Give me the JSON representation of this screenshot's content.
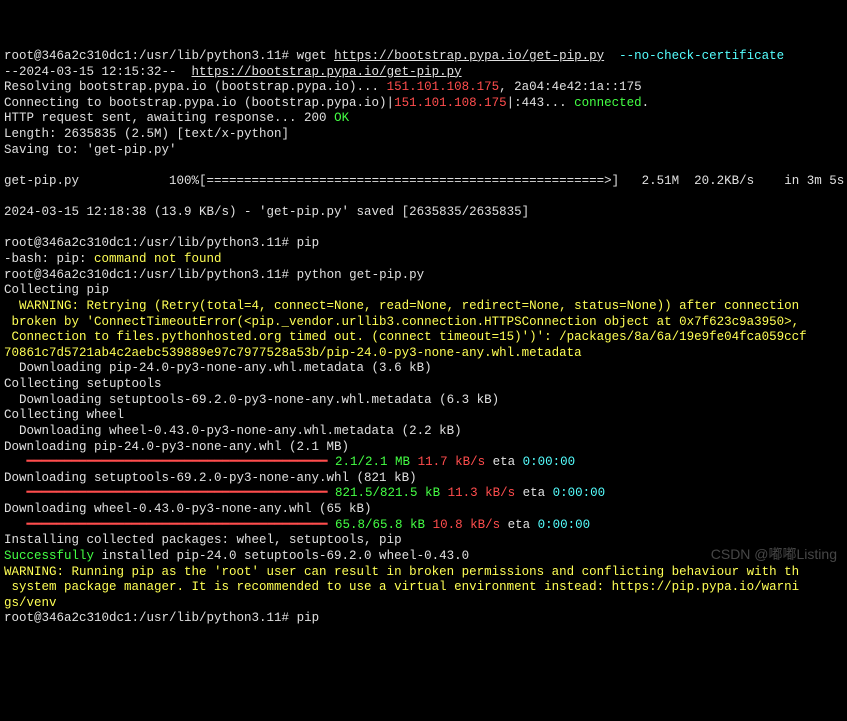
{
  "prompt": "root@346a2c310dc1:/usr/lib/python3.11#",
  "cmd": {
    "wget": "wget",
    "url": "https://bootstrap.pypa.io/get-pip.py",
    "flag": "--no-check-certificate",
    "pip": "pip",
    "python": "python get-pip.py"
  },
  "ts_start": "--2024-03-15 12:15:32--  ",
  "url2": "https://bootstrap.pypa.io/get-pip.py",
  "resolve_a": "Resolving bootstrap.pypa.io (bootstrap.pypa.io)... ",
  "ip1": "151.101.108.175",
  "resolve_b": ", 2a04:4e42:1a::175",
  "connect_a": "Connecting to bootstrap.pypa.io (bootstrap.pypa.io)|",
  "ip2": "151.101.108.175",
  "connect_b": "|:443... ",
  "connected": "connected",
  "dot": ".",
  "http_a": "HTTP request sent, awaiting response... 200 ",
  "ok": "OK",
  "length": "Length: 2635835 (2.5M) [text/x-python]",
  "saving": "Saving to: 'get-pip.py'",
  "prog_name": "get-pip.py",
  "prog_pct": "100%",
  "prog_bar": "[=====================================================>]",
  "prog_size": "2.51M",
  "prog_speed": "20.2KB/s",
  "prog_eta": "in 3m 5s",
  "ts_end": "2024-03-15 12:18:38 (13.9 KB/s) - 'get-pip.py' saved [2635835/2635835]",
  "bash_err_a": "-bash: pip: ",
  "bash_err_b": "command not found",
  "collect_pip": "Collecting pip",
  "warn1": "  WARNING: Retrying (Retry(total=4, connect=None, read=None, redirect=None, status=None)) after connection",
  "warn2": " broken by 'ConnectTimeoutError(<pip._vendor.urllib3.connection.HTTPSConnection object at 0x7f623c9a3950>,",
  "warn3": " Connection to files.pythonhosted.org timed out. (connect timeout=15)')': /packages/8a/6a/19e9fe04fca059ccf",
  "warn4": "70861c7d5721ab4c2aebc539889e97c7977528a53b/pip-24.0-py3-none-any.whl.metadata",
  "dl_pip_meta": "  Downloading pip-24.0-py3-none-any.whl.metadata (3.6 kB)",
  "collect_setup": "Collecting setuptools",
  "dl_setup_meta": "  Downloading setuptools-69.2.0-py3-none-any.whl.metadata (6.3 kB)",
  "collect_wheel": "Collecting wheel",
  "dl_wheel_meta": "  Downloading wheel-0.43.0-py3-none-any.whl.metadata (2.2 kB)",
  "dl_pip": "Downloading pip-24.0-py3-none-any.whl (2.1 MB)",
  "bar": "   ━━━━━━━━━━━━━━━━━━━━━━━━━━━━━━━━━━━━━━━━",
  "p1_size": "2.1/2.1 MB",
  "p1_speed": "11.7 kB/s",
  "eta_lbl": "eta",
  "p1_eta": "0:00:00",
  "dl_setup": "Downloading setuptools-69.2.0-py3-none-any.whl (821 kB)",
  "p2_size": "821.5/821.5 kB",
  "p2_speed": "11.3 kB/s",
  "p2_eta": "0:00:00",
  "dl_wheel": "Downloading wheel-0.43.0-py3-none-any.whl (65 kB)",
  "p3_size": "65.8/65.8 kB",
  "p3_speed": "10.8 kB/s",
  "p3_eta": "0:00:00",
  "install": "Installing collected packages: wheel, setuptools, pip",
  "succ_a": "Successfully",
  "succ_b": " installed pip-24.0 setuptools-69.2.0 wheel-0.43.0",
  "rootwarn1": "WARNING: Running pip as the 'root' user can result in broken permissions and conflicting behaviour with th",
  "rootwarn2": " system package manager. It is recommended to use a virtual environment instead: https://pip.pypa.io/warni",
  "rootwarn3": "gs/venv",
  "watermark": "CSDN @嘟嘟Listing"
}
